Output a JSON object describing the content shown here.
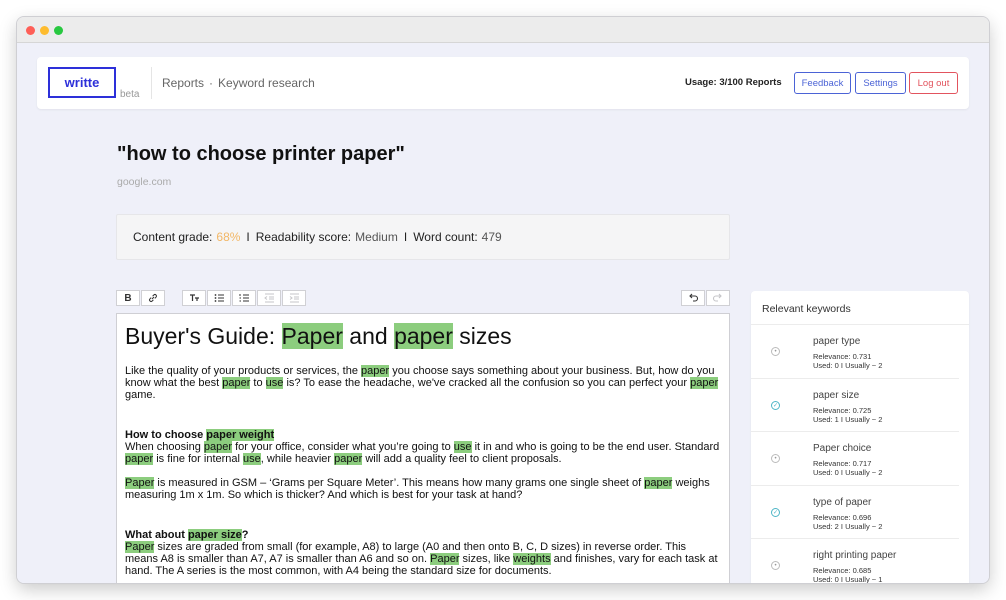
{
  "brand": {
    "logo": "writte",
    "badge": "beta"
  },
  "breadcrumb": {
    "items": [
      "Reports",
      "Keyword research"
    ],
    "separator": "·"
  },
  "header": {
    "usage": "Usage: 3/100 Reports",
    "feedback_label": "Feedback",
    "settings_label": "Settings",
    "logout_label": "Log out"
  },
  "page": {
    "title": "\"how to choose printer paper\"",
    "source": "google.com"
  },
  "stats": {
    "grade_label": "Content grade:",
    "grade_value": "68%",
    "separator": "I",
    "readability_label": "Readability score:",
    "readability_value": "Medium",
    "wordcount_label": "Word count:",
    "wordcount_value": "479"
  },
  "toolbar": {
    "bold": "B",
    "link": "link-icon",
    "text_size": "text-size-icon",
    "bullet_list": "bullet-list-icon",
    "numbered_list": "numbered-list-icon",
    "outdent": "outdent-icon",
    "indent": "indent-icon",
    "undo": "undo-icon",
    "redo": "redo-icon"
  },
  "editor": {
    "heading": [
      {
        "t": "Buyer's Guide: "
      },
      {
        "t": "Paper",
        "hl": true
      },
      {
        "t": " and "
      },
      {
        "t": "paper",
        "hl": true
      },
      {
        "t": " sizes"
      }
    ],
    "paragraphs": [
      {
        "gap": true,
        "runs": [
          {
            "t": "Like the quality of your products or services, the "
          },
          {
            "t": "paper",
            "hl": true
          },
          {
            "t": " you choose says something about your business. But, how do you know what the best "
          },
          {
            "t": "paper",
            "hl": true
          },
          {
            "t": " to "
          },
          {
            "t": "use",
            "hl": true
          },
          {
            "t": " is? To ease the headache, we've cracked all the confusion so you can perfect your "
          },
          {
            "t": "paper",
            "hl": true
          },
          {
            "t": " game."
          }
        ]
      },
      {
        "runs": [
          {
            "t": "How to choose ",
            "b": true
          },
          {
            "t": "paper weight",
            "b": true,
            "hl": true
          },
          {
            "br": true
          },
          {
            "t": "When choosing "
          },
          {
            "t": "paper",
            "hl": true
          },
          {
            "t": " for your office, consider what you’re going to "
          },
          {
            "t": "use",
            "hl": true
          },
          {
            "t": " it in and who is going to be the end user. Standard "
          },
          {
            "t": "paper",
            "hl": true
          },
          {
            "t": " is fine for internal "
          },
          {
            "t": "use",
            "hl": true
          },
          {
            "t": ", while heavier "
          },
          {
            "t": "paper",
            "hl": true
          },
          {
            "t": " will add a quality feel to client proposals."
          }
        ]
      },
      {
        "gap": true,
        "runs": [
          {
            "t": "Paper",
            "hl": true
          },
          {
            "t": " is measured in GSM – ‘Grams per Square Meter’. This means how many grams one single sheet of "
          },
          {
            "t": "paper",
            "hl": true
          },
          {
            "t": " weighs measuring 1m x 1m. So which is thicker? And which is best for your task at hand?"
          }
        ]
      },
      {
        "runs": [
          {
            "t": "What about ",
            "b": true
          },
          {
            "t": "paper size",
            "b": true,
            "hl": true
          },
          {
            "t": "?",
            "b": true
          },
          {
            "br": true
          },
          {
            "t": "Paper",
            "hl": true
          },
          {
            "t": " sizes are graded from small (for example, A8) to large (A0 and then onto B, C, D sizes) in reverse order. This means A8 is smaller than A7, A7 is smaller than A6 and so on. "
          },
          {
            "t": "Paper",
            "hl": true
          },
          {
            "t": " sizes, like "
          },
          {
            "t": "weights",
            "hl": true
          },
          {
            "t": " and finishes, vary for each task at hand. The A series is the most common, with A4 being the standard size for documents."
          }
        ]
      }
    ]
  },
  "keywords": {
    "header": "Relevant keywords",
    "items": [
      {
        "title": "paper type",
        "relevance": "Relevance: 0.731",
        "usage": "Used: 0 I Usually ~ 2",
        "status": "unused"
      },
      {
        "title": "paper size",
        "relevance": "Relevance: 0.725",
        "usage": "Used: 1 I Usually ~ 2",
        "status": "used"
      },
      {
        "title": "Paper choice",
        "relevance": "Relevance: 0.717",
        "usage": "Used: 0 I Usually ~ 2",
        "status": "unused"
      },
      {
        "title": "type of paper",
        "relevance": "Relevance: 0.696",
        "usage": "Used: 2 I Usually ~ 2",
        "status": "used"
      },
      {
        "title": "right printing paper",
        "relevance": "Relevance: 0.685",
        "usage": "Used: 0 I Usually ~ 1",
        "status": "unused"
      }
    ]
  },
  "colors": {
    "accent": "#2d30d9",
    "button_blue": "#4b63d6",
    "logout_red": "#e2545e",
    "highlight": "#8ccd7e",
    "grade": "#f2b766",
    "used_icon": "#4fb6c7"
  }
}
